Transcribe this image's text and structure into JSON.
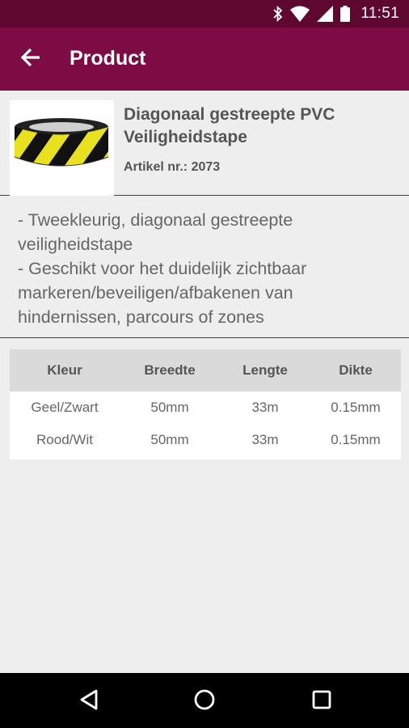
{
  "status_bar": {
    "time": "11:51",
    "icons": [
      "bluetooth-icon",
      "wifi-icon",
      "signal-icon",
      "battery-icon"
    ]
  },
  "app_bar": {
    "title": "Product",
    "back_icon": "arrow-left-icon",
    "background": "#7d0b44"
  },
  "product": {
    "name": "Diagonaal gestreepte PVC Veiligheidstape",
    "article_label": "Artikel nr.: 2073",
    "image": "yellow-black-striped-tape-roll"
  },
  "description": [
    "- Tweekleurig, diagonaal gestreepte veiligheidstape",
    "- Geschikt voor het duidelijk zichtbaar markeren/beveiligen/afbakenen van hindernissen, parcours of zones"
  ],
  "spec_table": {
    "headers": [
      "Kleur",
      "Breedte",
      "Lengte",
      "Dikte"
    ],
    "rows": [
      [
        "Geel/Zwart",
        "50mm",
        "33m",
        "0.15mm"
      ],
      [
        "Rood/Wit",
        "50mm",
        "33m",
        "0.15mm"
      ]
    ]
  },
  "nav_bar": {
    "buttons": [
      "back-triangle-icon",
      "home-circle-icon",
      "recents-square-icon"
    ]
  }
}
